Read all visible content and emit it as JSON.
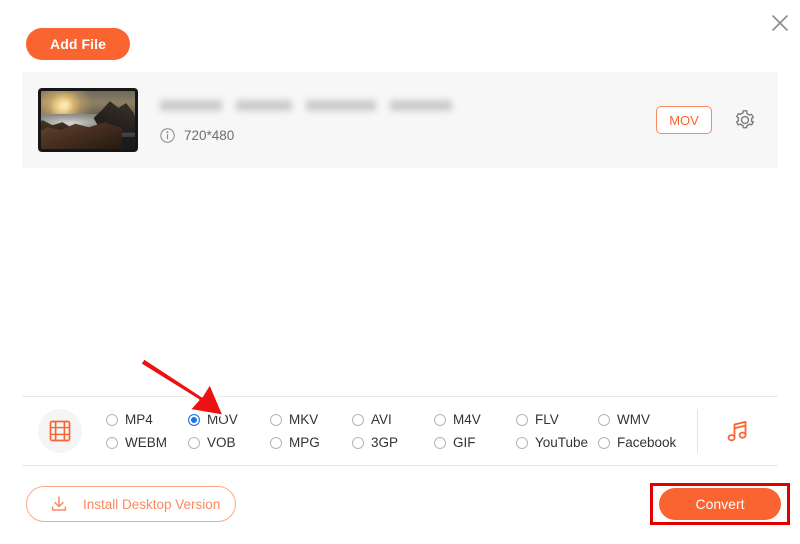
{
  "window": {
    "close_label": "×",
    "close_icon": "close-icon"
  },
  "toolbar": {
    "add_file_label": "Add File"
  },
  "file_item": {
    "name_blurred": true,
    "name_blur_widths": [
      62,
      56,
      70,
      62
    ],
    "dimensions": "720*480",
    "info_icon": "info-icon",
    "output_format": "MOV",
    "settings_icon": "gear-icon",
    "thumbnail_alt": "coastal sunset video thumbnail"
  },
  "format_panel": {
    "category_icon": "film-strip-icon",
    "audio_icon": "music-note-icon",
    "selected": "MOV",
    "options": [
      {
        "label": "MP4",
        "selected": false
      },
      {
        "label": "MOV",
        "selected": true
      },
      {
        "label": "MKV",
        "selected": false
      },
      {
        "label": "AVI",
        "selected": false
      },
      {
        "label": "M4V",
        "selected": false
      },
      {
        "label": "FLV",
        "selected": false
      },
      {
        "label": "WMV",
        "selected": false
      },
      {
        "label": "WEBM",
        "selected": false
      },
      {
        "label": "VOB",
        "selected": false
      },
      {
        "label": "MPG",
        "selected": false
      },
      {
        "label": "3GP",
        "selected": false
      },
      {
        "label": "GIF",
        "selected": false
      },
      {
        "label": "YouTube",
        "selected": false
      },
      {
        "label": "Facebook",
        "selected": false
      }
    ]
  },
  "footer": {
    "install_label": "Install Desktop Version",
    "install_icon": "download-icon",
    "convert_label": "Convert"
  },
  "annotations": {
    "arrow_icon": "red-arrow-pointer",
    "highlight_target": "Convert"
  },
  "colors": {
    "accent": "#fa6431",
    "accent_light": "#fbaa86",
    "radio_selected": "#1a73e8",
    "annotation_red": "#e00000",
    "card_bg": "#f7f7f7"
  }
}
